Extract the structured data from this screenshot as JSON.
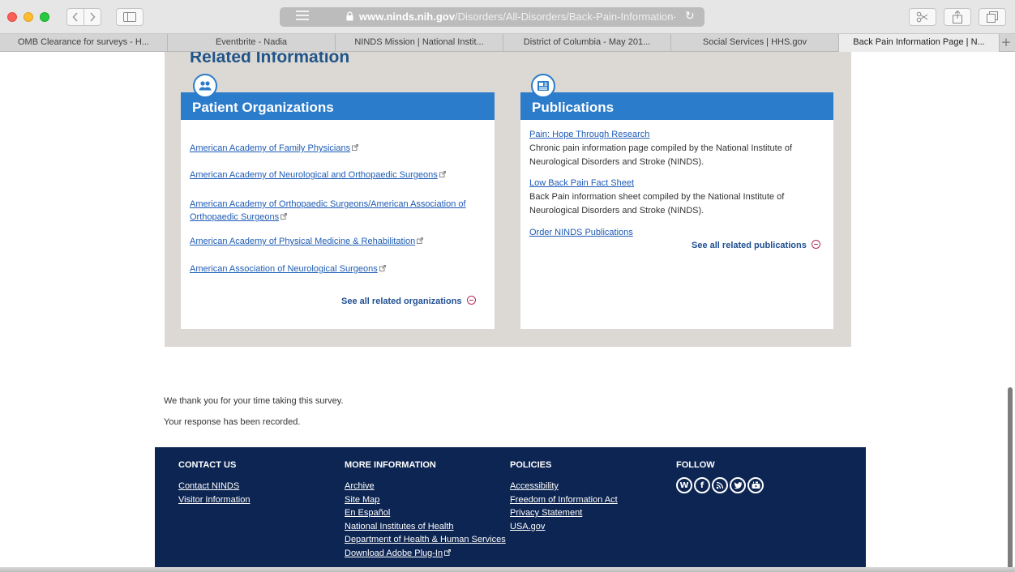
{
  "browser": {
    "url_host": "www.ninds.nih.gov",
    "url_path": "/Disorders/All-Disorders/Back-Pain-Information-P",
    "tabs": [
      {
        "label": "OMB Clearance for surveys - H..."
      },
      {
        "label": "Eventbrite - Nadia"
      },
      {
        "label": "NINDS Mission | National Instit..."
      },
      {
        "label": "District of Columbia - May 201..."
      },
      {
        "label": "Social Services | HHS.gov"
      },
      {
        "label": "Back Pain Information Page | N..."
      }
    ],
    "active_tab_index": 5,
    "new_tab_label": "+"
  },
  "related": {
    "heading": "Related Information",
    "organizations": {
      "title": "Patient Organizations",
      "links": [
        {
          "label": "American Academy of Family Physicians"
        },
        {
          "label": "American Academy of Neurological and Orthopaedic Surgeons"
        },
        {
          "label": "American Academy of Orthopaedic Surgeons/American Association of",
          "label2": "Orthopaedic Surgeons"
        },
        {
          "label": "American Academy of Physical Medicine & Rehabilitation"
        },
        {
          "label": "American Association of Neurological Surgeons"
        }
      ],
      "see_all": "See all related organizations"
    },
    "publications": {
      "title": "Publications",
      "items": [
        {
          "label": "Pain: Hope Through Research",
          "desc": "Chronic pain information page compiled by the National Institute of Neurological Disorders and Stroke (NINDS)."
        },
        {
          "label": "Low Back Pain Fact Sheet",
          "desc": "Back Pain information sheet compiled by the National Institute of Neurological Disorders and Stroke (NINDS)."
        },
        {
          "label": "Order NINDS Publications",
          "desc": ""
        }
      ],
      "see_all": "See all related publications"
    }
  },
  "survey": {
    "thanks": "We thank you for your time taking this survey.",
    "recorded": "Your response has been recorded."
  },
  "footer": {
    "contact": {
      "heading": "CONTACT US",
      "links": [
        "Contact NINDS",
        "Visitor Information"
      ]
    },
    "more": {
      "heading": "MORE INFORMATION",
      "links": [
        "Archive",
        "Site Map",
        "En Español",
        "National Institutes of Health",
        "Department of Health & Human Services",
        "Download Adobe Plug-In"
      ]
    },
    "policies": {
      "heading": "POLICIES",
      "links": [
        "Accessibility",
        "Freedom of Information Act",
        "Privacy Statement",
        "USA.gov"
      ]
    },
    "follow": {
      "heading": "FOLLOW",
      "icons": [
        "wordpress-icon",
        "facebook-icon",
        "rss-icon",
        "twitter-icon",
        "youtube-icon"
      ]
    }
  },
  "colors": {
    "panel": "#dcd8d3",
    "card_header": "#2b7ccb",
    "heading": "#20558a",
    "link": "#1e5bb5",
    "footer": "#0d2552",
    "see_all_arrow": "#b5295a"
  }
}
